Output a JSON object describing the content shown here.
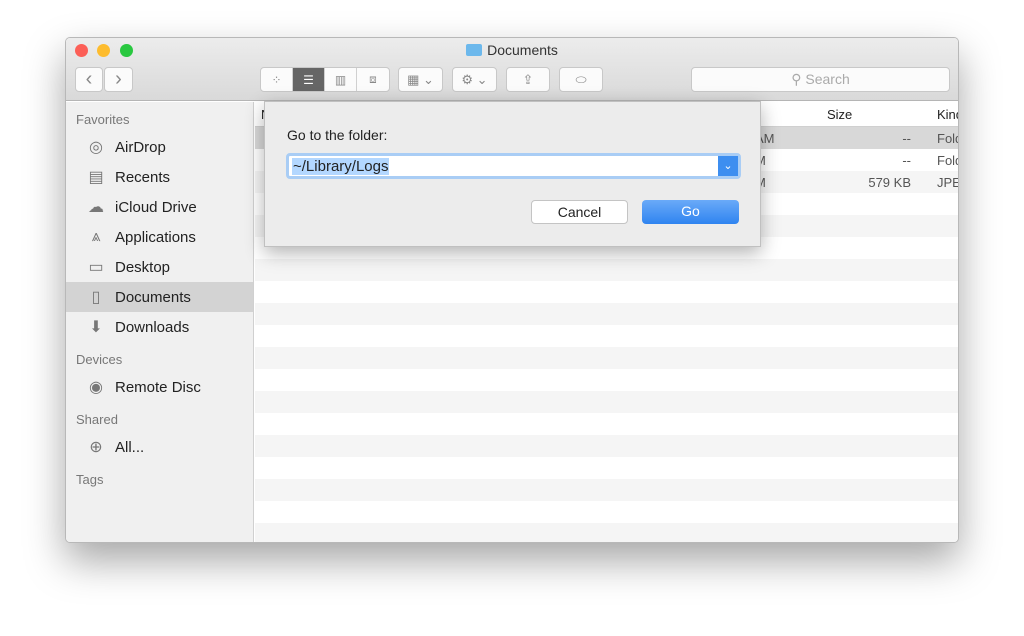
{
  "window": {
    "title": "Documents"
  },
  "toolbar": {
    "back": "‹",
    "forward": "›",
    "search_placeholder": "Search",
    "views": [
      "icon",
      "list",
      "column",
      "cover-flow"
    ],
    "active_view": "list"
  },
  "sidebar": {
    "sections": [
      {
        "label": "Favorites",
        "items": [
          {
            "label": "AirDrop",
            "icon": "airdrop-icon",
            "glyph": "◎"
          },
          {
            "label": "Recents",
            "icon": "recents-icon",
            "glyph": "▤"
          },
          {
            "label": "iCloud Drive",
            "icon": "cloud-icon",
            "glyph": "☁"
          },
          {
            "label": "Applications",
            "icon": "applications-icon",
            "glyph": "⩓"
          },
          {
            "label": "Desktop",
            "icon": "desktop-icon",
            "glyph": "▭"
          },
          {
            "label": "Documents",
            "icon": "documents-icon",
            "glyph": "▯",
            "selected": true
          },
          {
            "label": "Downloads",
            "icon": "downloads-icon",
            "glyph": "⬇"
          }
        ]
      },
      {
        "label": "Devices",
        "items": [
          {
            "label": "Remote Disc",
            "icon": "disc-icon",
            "glyph": "◉"
          }
        ]
      },
      {
        "label": "Shared",
        "items": [
          {
            "label": "All...",
            "icon": "network-icon",
            "glyph": "⊕"
          }
        ]
      },
      {
        "label": "Tags",
        "items": []
      }
    ]
  },
  "list": {
    "columns": {
      "name": "N",
      "size": "Size",
      "kind": "Kind"
    },
    "rows": [
      {
        "date": "AM",
        "size": "--",
        "kind": "Folder"
      },
      {
        "date": "M",
        "size": "--",
        "kind": "Folder"
      },
      {
        "date": "M",
        "size": "579 KB",
        "kind": "JPEG"
      }
    ]
  },
  "dialog": {
    "label": "Go to the folder:",
    "value": "~/Library/Logs",
    "cancel": "Cancel",
    "go": "Go"
  },
  "colors": {
    "accent": "#3d8ef0",
    "selection": "#b3d7ff"
  }
}
